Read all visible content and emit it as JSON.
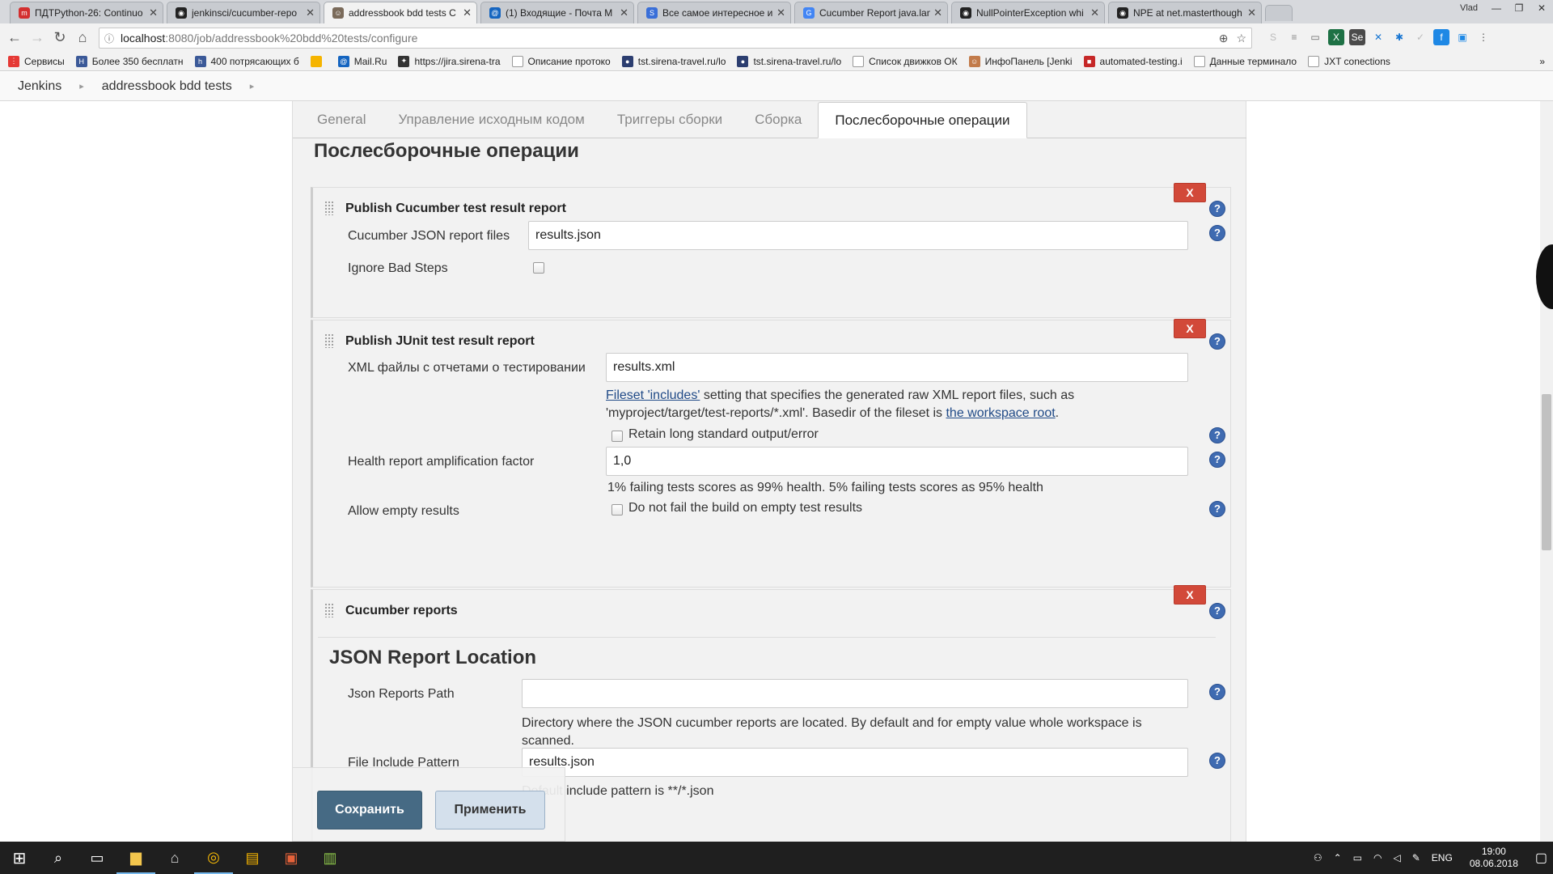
{
  "browser": {
    "tabs": [
      {
        "title": "ПДТPython-26: Continuo",
        "icon_color": "#d32f2f",
        "icon": "m"
      },
      {
        "title": "jenkinsci/cucumber-repo",
        "icon_color": "#222222",
        "icon": "◉"
      },
      {
        "title": "addressbook bdd tests C",
        "icon_color": "#7a6a5a",
        "icon": "☺"
      },
      {
        "title": "(1) Входящие - Почта M",
        "icon_color": "#1565c0",
        "icon": "@"
      },
      {
        "title": "Все самое интересное и",
        "icon_color": "#3a6fd8",
        "icon": "S"
      },
      {
        "title": "Cucumber Report java.lan",
        "icon_color": "#4285f4",
        "icon": "G"
      },
      {
        "title": "NullPointerException whi",
        "icon_color": "#222222",
        "icon": "◉"
      },
      {
        "title": "NPE at net.masterthough",
        "icon_color": "#222222",
        "icon": "◉"
      }
    ],
    "window_user": "Vlad",
    "url_host": "localhost",
    "url_path": ":8080/job/addressbook%20bdd%20tests/configure",
    "bookmarks": [
      {
        "label": "Сервисы",
        "color": "#e53935"
      },
      {
        "label": "Более 350 бесплатн",
        "color": "#3b5998"
      },
      {
        "label": "400 потрясающих б",
        "color": "#3b5998"
      },
      {
        "label": "",
        "color": "#f5b400"
      },
      {
        "label": "Mail.Ru",
        "color": "#1565c0"
      },
      {
        "label": "https://jira.sirena-tra",
        "color": "#333333"
      },
      {
        "label": "Описание протоко",
        "color": "#999999"
      },
      {
        "label": "tst.sirena-travel.ru/lo",
        "color": "#2c3e70"
      },
      {
        "label": "tst.sirena-travel.ru/lo",
        "color": "#2c3e70"
      },
      {
        "label": "Список движков ОК",
        "color": "#999999"
      },
      {
        "label": "ИнфоПанель [Jenki",
        "color": "#c27b4a"
      },
      {
        "label": "automated-testing.i",
        "color": "#c62828"
      },
      {
        "label": "Данные терминало",
        "color": "#999999"
      },
      {
        "label": "JXT conections",
        "color": "#999999"
      }
    ]
  },
  "breadcrumb": [
    "Jenkins",
    "addressbook bdd tests"
  ],
  "config_tabs": [
    {
      "label": "General",
      "active": false
    },
    {
      "label": "Управление исходным кодом",
      "active": false
    },
    {
      "label": "Триггеры сборки",
      "active": false
    },
    {
      "label": "Сборка",
      "active": false
    },
    {
      "label": "Послесборочные операции",
      "active": true
    }
  ],
  "section_title": "Послесборочные операции",
  "delete_label": "X",
  "help_glyph": "?",
  "cucumber_result": {
    "title": "Publish Cucumber test result report",
    "json_files_label": "Cucumber JSON report files",
    "json_files_value": "results.json",
    "ignore_bad_steps_label": "Ignore Bad Steps"
  },
  "junit": {
    "title": "Publish JUnit test result report",
    "xml_label": "XML файлы с отчетами о тестировании",
    "xml_value": "results.xml",
    "fileset_link": "Fileset 'includes'",
    "fileset_text1": " setting that specifies the generated raw XML report files, such as",
    "fileset_text2": "'myproject/target/test-reports/*.xml'. Basedir of the fileset is ",
    "workspace_link": "the workspace root",
    "period": ".",
    "retain_label": "Retain long standard output/error",
    "health_label": "Health report amplification factor",
    "health_value": "1,0",
    "health_desc": "1% failing tests scores as 99% health. 5% failing tests scores as 95% health",
    "allow_empty_label": "Allow empty results",
    "allow_empty_check": "Do not fail the build on empty test results"
  },
  "cucumber_reports": {
    "title": "Cucumber reports",
    "location_heading": "JSON Report Location",
    "path_label": "Json Reports Path",
    "path_value": "",
    "path_desc1": "Directory where the JSON cucumber reports are located. By default and for empty value whole workspace is",
    "path_desc2": "scanned.",
    "pattern_label": "File Include Pattern",
    "pattern_value": "results.json",
    "pattern_desc": "Default include pattern is **/*.json"
  },
  "buttons": {
    "save": "Сохранить",
    "apply": "Применить"
  },
  "taskbar": {
    "lang": "ENG",
    "time": "19:00",
    "date": "08.06.2018"
  }
}
